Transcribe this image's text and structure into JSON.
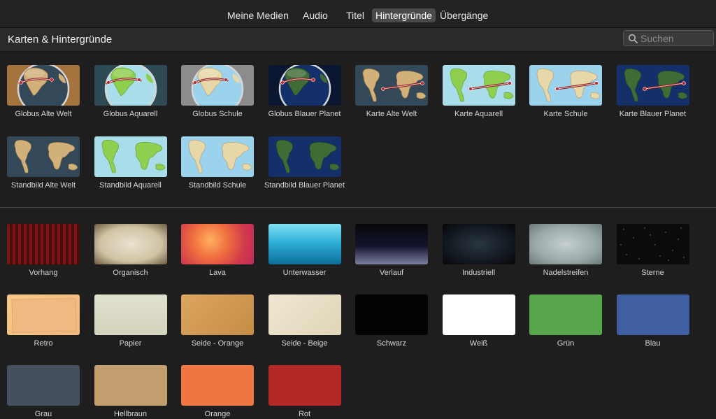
{
  "tabs": [
    {
      "label": "Meine Medien",
      "active": false
    },
    {
      "label": "Audio",
      "active": false
    },
    {
      "label": "Titel",
      "active": false
    },
    {
      "label": "Hintergründe",
      "active": true
    },
    {
      "label": "Übergänge",
      "active": false
    }
  ],
  "header": {
    "title": "Karten & Hintergründe"
  },
  "search": {
    "placeholder": "Suchen",
    "icon": "search-icon"
  },
  "maps": [
    {
      "label": "Globus Alte Welt",
      "style": "globe-oldworld"
    },
    {
      "label": "Globus Aquarell",
      "style": "globe-aquarell"
    },
    {
      "label": "Globus Schule",
      "style": "globe-school"
    },
    {
      "label": "Globus Blauer Planet",
      "style": "globe-blue"
    },
    {
      "label": "Karte Alte Welt",
      "style": "map-oldworld"
    },
    {
      "label": "Karte Aquarell",
      "style": "map-aquarell"
    },
    {
      "label": "Karte Schule",
      "style": "map-school"
    },
    {
      "label": "Karte Blauer Planet",
      "style": "map-blue"
    },
    {
      "label": "Standbild Alte Welt",
      "style": "still-oldworld"
    },
    {
      "label": "Standbild Aquarell",
      "style": "still-aquarell"
    },
    {
      "label": "Standbild Schule",
      "style": "still-school"
    },
    {
      "label": "Standbild Blauer Planet",
      "style": "still-blue"
    }
  ],
  "backgrounds": [
    {
      "label": "Vorhang",
      "style": "curtain"
    },
    {
      "label": "Organisch",
      "style": "organic"
    },
    {
      "label": "Lava",
      "style": "lava"
    },
    {
      "label": "Unterwasser",
      "style": "underwater"
    },
    {
      "label": "Verlauf",
      "style": "gradient"
    },
    {
      "label": "Industriell",
      "style": "industrial"
    },
    {
      "label": "Nadelstreifen",
      "style": "pinstripe"
    },
    {
      "label": "Sterne",
      "style": "stars"
    },
    {
      "label": "Retro",
      "style": "retro"
    },
    {
      "label": "Papier",
      "style": "paper"
    },
    {
      "label": "Seide - Orange",
      "style": "silk-orange"
    },
    {
      "label": "Seide - Beige",
      "style": "silk-beige"
    },
    {
      "label": "Schwarz",
      "style": "solid",
      "color": "#030303"
    },
    {
      "label": "Weiß",
      "style": "solid",
      "color": "#ffffff"
    },
    {
      "label": "Grün",
      "style": "solid",
      "color": "#58a64c"
    },
    {
      "label": "Blau",
      "style": "solid",
      "color": "#3f5fa0"
    },
    {
      "label": "Grau",
      "style": "solid",
      "color": "#45505e"
    },
    {
      "label": "Hellbraun",
      "style": "solid",
      "color": "#c39e6e"
    },
    {
      "label": "Orange",
      "style": "solid",
      "color": "#ef7640"
    },
    {
      "label": "Rot",
      "style": "solid",
      "color": "#b42828"
    }
  ]
}
